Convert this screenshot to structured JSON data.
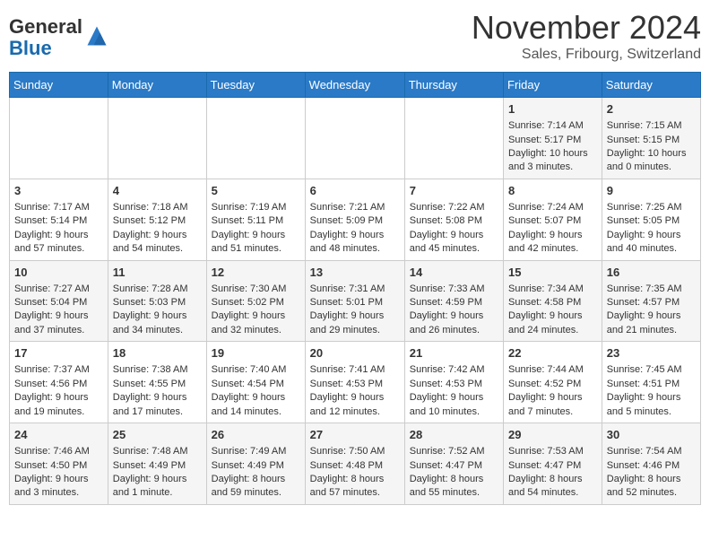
{
  "header": {
    "logo_general": "General",
    "logo_blue": "Blue",
    "month_year": "November 2024",
    "location": "Sales, Fribourg, Switzerland"
  },
  "days_of_week": [
    "Sunday",
    "Monday",
    "Tuesday",
    "Wednesday",
    "Thursday",
    "Friday",
    "Saturday"
  ],
  "weeks": [
    [
      {
        "day": "",
        "info": ""
      },
      {
        "day": "",
        "info": ""
      },
      {
        "day": "",
        "info": ""
      },
      {
        "day": "",
        "info": ""
      },
      {
        "day": "",
        "info": ""
      },
      {
        "day": "1",
        "info": "Sunrise: 7:14 AM\nSunset: 5:17 PM\nDaylight: 10 hours and 3 minutes."
      },
      {
        "day": "2",
        "info": "Sunrise: 7:15 AM\nSunset: 5:15 PM\nDaylight: 10 hours and 0 minutes."
      }
    ],
    [
      {
        "day": "3",
        "info": "Sunrise: 7:17 AM\nSunset: 5:14 PM\nDaylight: 9 hours and 57 minutes."
      },
      {
        "day": "4",
        "info": "Sunrise: 7:18 AM\nSunset: 5:12 PM\nDaylight: 9 hours and 54 minutes."
      },
      {
        "day": "5",
        "info": "Sunrise: 7:19 AM\nSunset: 5:11 PM\nDaylight: 9 hours and 51 minutes."
      },
      {
        "day": "6",
        "info": "Sunrise: 7:21 AM\nSunset: 5:09 PM\nDaylight: 9 hours and 48 minutes."
      },
      {
        "day": "7",
        "info": "Sunrise: 7:22 AM\nSunset: 5:08 PM\nDaylight: 9 hours and 45 minutes."
      },
      {
        "day": "8",
        "info": "Sunrise: 7:24 AM\nSunset: 5:07 PM\nDaylight: 9 hours and 42 minutes."
      },
      {
        "day": "9",
        "info": "Sunrise: 7:25 AM\nSunset: 5:05 PM\nDaylight: 9 hours and 40 minutes."
      }
    ],
    [
      {
        "day": "10",
        "info": "Sunrise: 7:27 AM\nSunset: 5:04 PM\nDaylight: 9 hours and 37 minutes."
      },
      {
        "day": "11",
        "info": "Sunrise: 7:28 AM\nSunset: 5:03 PM\nDaylight: 9 hours and 34 minutes."
      },
      {
        "day": "12",
        "info": "Sunrise: 7:30 AM\nSunset: 5:02 PM\nDaylight: 9 hours and 32 minutes."
      },
      {
        "day": "13",
        "info": "Sunrise: 7:31 AM\nSunset: 5:01 PM\nDaylight: 9 hours and 29 minutes."
      },
      {
        "day": "14",
        "info": "Sunrise: 7:33 AM\nSunset: 4:59 PM\nDaylight: 9 hours and 26 minutes."
      },
      {
        "day": "15",
        "info": "Sunrise: 7:34 AM\nSunset: 4:58 PM\nDaylight: 9 hours and 24 minutes."
      },
      {
        "day": "16",
        "info": "Sunrise: 7:35 AM\nSunset: 4:57 PM\nDaylight: 9 hours and 21 minutes."
      }
    ],
    [
      {
        "day": "17",
        "info": "Sunrise: 7:37 AM\nSunset: 4:56 PM\nDaylight: 9 hours and 19 minutes."
      },
      {
        "day": "18",
        "info": "Sunrise: 7:38 AM\nSunset: 4:55 PM\nDaylight: 9 hours and 17 minutes."
      },
      {
        "day": "19",
        "info": "Sunrise: 7:40 AM\nSunset: 4:54 PM\nDaylight: 9 hours and 14 minutes."
      },
      {
        "day": "20",
        "info": "Sunrise: 7:41 AM\nSunset: 4:53 PM\nDaylight: 9 hours and 12 minutes."
      },
      {
        "day": "21",
        "info": "Sunrise: 7:42 AM\nSunset: 4:53 PM\nDaylight: 9 hours and 10 minutes."
      },
      {
        "day": "22",
        "info": "Sunrise: 7:44 AM\nSunset: 4:52 PM\nDaylight: 9 hours and 7 minutes."
      },
      {
        "day": "23",
        "info": "Sunrise: 7:45 AM\nSunset: 4:51 PM\nDaylight: 9 hours and 5 minutes."
      }
    ],
    [
      {
        "day": "24",
        "info": "Sunrise: 7:46 AM\nSunset: 4:50 PM\nDaylight: 9 hours and 3 minutes."
      },
      {
        "day": "25",
        "info": "Sunrise: 7:48 AM\nSunset: 4:49 PM\nDaylight: 9 hours and 1 minute."
      },
      {
        "day": "26",
        "info": "Sunrise: 7:49 AM\nSunset: 4:49 PM\nDaylight: 8 hours and 59 minutes."
      },
      {
        "day": "27",
        "info": "Sunrise: 7:50 AM\nSunset: 4:48 PM\nDaylight: 8 hours and 57 minutes."
      },
      {
        "day": "28",
        "info": "Sunrise: 7:52 AM\nSunset: 4:47 PM\nDaylight: 8 hours and 55 minutes."
      },
      {
        "day": "29",
        "info": "Sunrise: 7:53 AM\nSunset: 4:47 PM\nDaylight: 8 hours and 54 minutes."
      },
      {
        "day": "30",
        "info": "Sunrise: 7:54 AM\nSunset: 4:46 PM\nDaylight: 8 hours and 52 minutes."
      }
    ]
  ]
}
